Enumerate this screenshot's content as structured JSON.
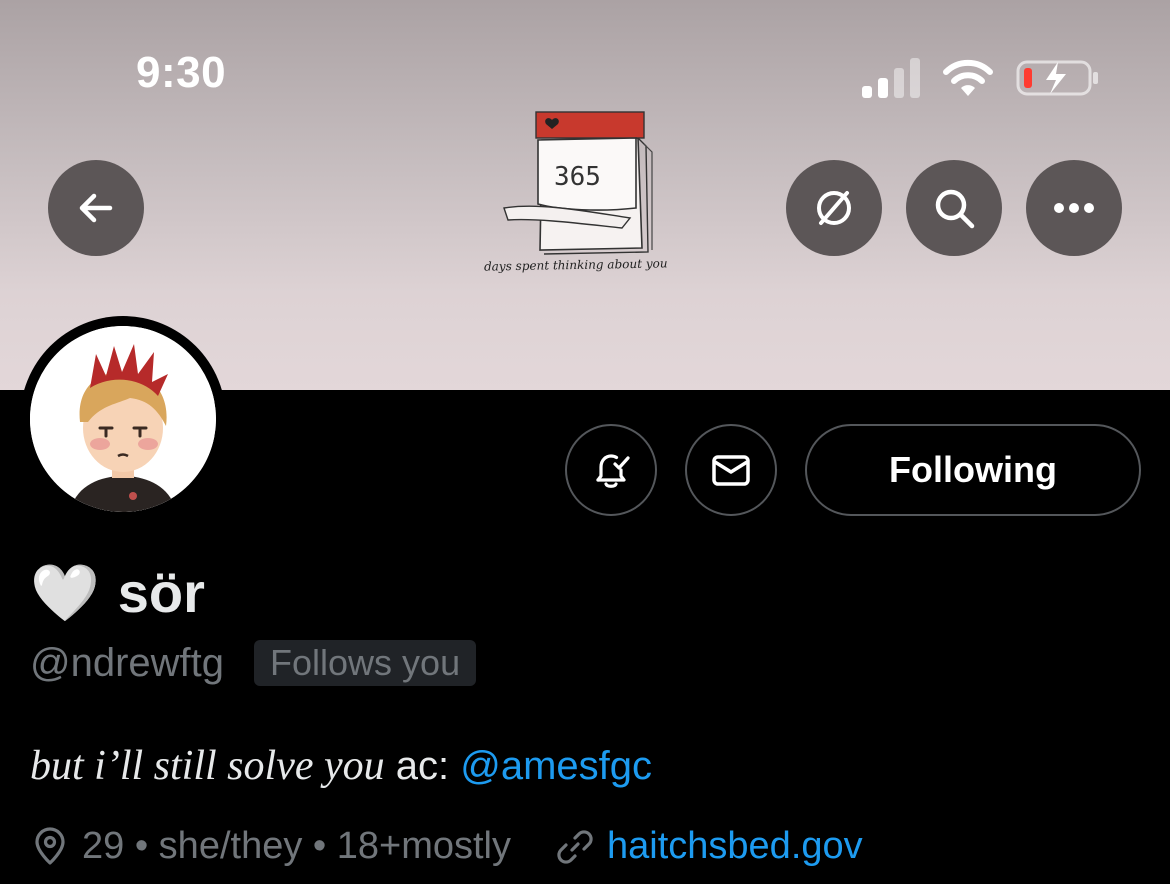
{
  "status_bar": {
    "time": "9:30",
    "icons": [
      "cellular-signal-icon",
      "wifi-icon",
      "battery-charging-icon"
    ]
  },
  "banner": {
    "calendar_number": "365",
    "caption": "days spent thinking about you"
  },
  "nav": {
    "back_icon": "arrow-left-icon",
    "actions": [
      "hide-icon",
      "search-icon",
      "more-icon"
    ]
  },
  "profile": {
    "display_name": "sör",
    "emoji": "🤍",
    "handle": "@ndrewftg",
    "follows_you": "Follows you",
    "bio_italic": "but i’ll still solve you",
    "bio_text": " ac: ",
    "bio_mention": "@amesfgc",
    "location": "29 • she/they • 18+mostly",
    "website": "haitchsbed.gov"
  },
  "actions": {
    "notifications_icon": "bell-check-icon",
    "message_icon": "envelope-icon",
    "following_label": "Following"
  },
  "colors": {
    "accent": "#1d9bf0",
    "muted": "#71767b",
    "text": "#e7e9ea"
  }
}
